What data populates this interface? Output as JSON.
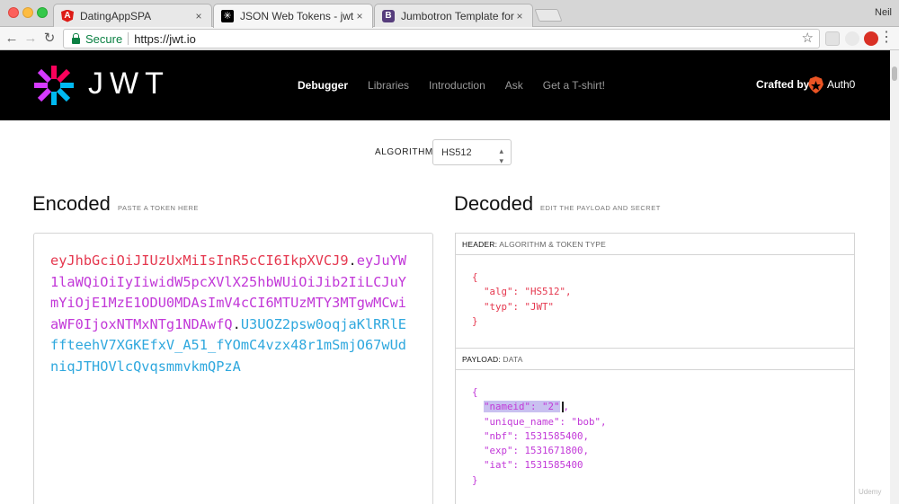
{
  "browser": {
    "tabs": [
      {
        "title": "DatingAppSPA",
        "favicon": "angular-icon",
        "active": false
      },
      {
        "title": "JSON Web Tokens - jwt.io",
        "favicon": "jwt-icon",
        "active": true
      },
      {
        "title": "Jumbotron Template for Bootst",
        "favicon": "bootstrap-icon",
        "active": false
      }
    ],
    "profile_name": "Neil",
    "close_glyph": "×",
    "secure_label": "Secure",
    "url": "https://jwt.io"
  },
  "site": {
    "logo_text": "JWT",
    "nav": [
      "Debugger",
      "Libraries",
      "Introduction",
      "Ask",
      "Get a T-shirt!"
    ],
    "crafted_by": "Crafted by",
    "auth0": "Auth0",
    "colors": {
      "header_bg": "#000000",
      "token_header": "#e5384f",
      "token_payload": "#c238d8",
      "token_signature": "#2fa8de"
    }
  },
  "algorithm": {
    "label": "ALGORITHM",
    "selected": "HS512"
  },
  "encoded": {
    "title": "Encoded",
    "subtitle": "PASTE A TOKEN HERE",
    "token_header": "eyJhbGciOiJIUzUxMiIsInR5cCI6IkpXVCJ9",
    "token_payload": "eyJuYW1laWQiOiIyIiwidW5pcXVlX25hbWUiOiJib2IiLCJuYmYiOjE1MzE1ODU0MDAsImV4cCI6MTUzMTY3MTgwMCwiaWF0IjoxNTMxNTg1NDAwfQ",
    "token_signature": "U3UOZ2psw0oqjaKlRRlEffteehV7XGKEfxV_A51_fYOmC4vzx48r1mSmjO67wUdniqJTHOVlcQvqsmmvkmQPzA",
    "dot": "."
  },
  "decoded": {
    "title": "Decoded",
    "subtitle": "EDIT THE PAYLOAD AND SECRET",
    "header_panel": {
      "label": "HEADER:",
      "sublabel": "ALGORITHM & TOKEN TYPE"
    },
    "payload_panel": {
      "label": "PAYLOAD:",
      "sublabel": "DATA"
    },
    "header_json": {
      "open": "{",
      "close": "}",
      "lines": [
        "  \"alg\": \"HS512\",",
        "  \"typ\": \"JWT\""
      ]
    },
    "payload_json": {
      "open": "{",
      "close": "}",
      "highlighted": "\"nameid\": \"",
      "highlighted_tail": "2\"",
      "after_highlight": ",",
      "lines": [
        "  \"unique_name\": \"bob\",",
        "  \"nbf\": 1531585400,",
        "  \"exp\": 1531671800,",
        "  \"iat\": 1531585400"
      ]
    }
  },
  "watermark": "Udemy"
}
